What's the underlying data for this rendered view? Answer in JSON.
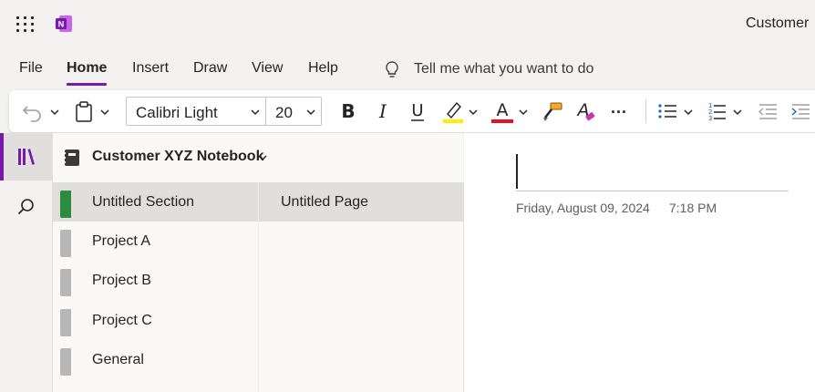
{
  "window": {
    "doc_title": "Customer"
  },
  "menu": {
    "tabs": [
      {
        "label": "File"
      },
      {
        "label": "Home",
        "active": true
      },
      {
        "label": "Insert"
      },
      {
        "label": "Draw"
      },
      {
        "label": "View"
      },
      {
        "label": "Help"
      }
    ],
    "tell_me": "Tell me what you want to do"
  },
  "ribbon": {
    "font_name": "Calibri Light",
    "font_size": "20",
    "more_label": "..."
  },
  "notebook": {
    "name": "Customer XYZ Notebook",
    "sections": [
      {
        "label": "Untitled Section",
        "color": "#2e8b3e",
        "selected": true
      },
      {
        "label": "Project A",
        "color": "#b7b7b7"
      },
      {
        "label": "Project B",
        "color": "#b7b7b7"
      },
      {
        "label": "Project C",
        "color": "#b7b7b7"
      },
      {
        "label": "General",
        "color": "#b7b7b7"
      }
    ],
    "pages": [
      {
        "label": "Untitled Page",
        "selected": true
      }
    ]
  },
  "page": {
    "date": "Friday, August 09, 2024",
    "time": "7:18 PM"
  },
  "colors": {
    "accent": "#7719aa",
    "highlight": "#ffee00",
    "font_color": "#e81123"
  }
}
